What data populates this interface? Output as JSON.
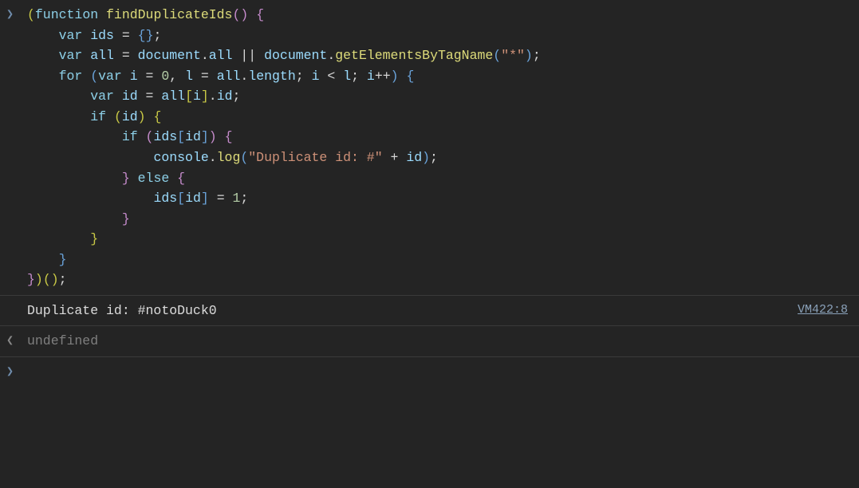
{
  "rows": [
    {
      "type": "input",
      "marker": "❯",
      "code_tokens": [
        [
          "t-paren",
          "("
        ],
        [
          "t-keyword",
          "function "
        ],
        [
          "t-name",
          "findDuplicateIds"
        ],
        [
          "t-paren2",
          "("
        ],
        [
          "t-paren2",
          ")"
        ],
        [
          "t-punc",
          " "
        ],
        [
          "t-paren2",
          "{"
        ],
        [
          "nl",
          ""
        ],
        [
          "indent",
          "    "
        ],
        [
          "t-keyword",
          "var "
        ],
        [
          "t-var",
          "ids"
        ],
        [
          "t-punc",
          " "
        ],
        [
          "t-op",
          "="
        ],
        [
          "t-punc",
          " "
        ],
        [
          "t-paren3",
          "{"
        ],
        [
          "t-paren3",
          "}"
        ],
        [
          "t-punc",
          ";"
        ],
        [
          "nl",
          ""
        ],
        [
          "indent",
          "    "
        ],
        [
          "t-keyword",
          "var "
        ],
        [
          "t-var",
          "all"
        ],
        [
          "t-punc",
          " "
        ],
        [
          "t-op",
          "="
        ],
        [
          "t-punc",
          " "
        ],
        [
          "t-var",
          "document"
        ],
        [
          "t-punc",
          "."
        ],
        [
          "t-var",
          "all"
        ],
        [
          "t-punc",
          " "
        ],
        [
          "t-op",
          "||"
        ],
        [
          "t-punc",
          " "
        ],
        [
          "t-var",
          "document"
        ],
        [
          "t-punc",
          "."
        ],
        [
          "t-method",
          "getElementsByTagName"
        ],
        [
          "t-paren3",
          "("
        ],
        [
          "t-str",
          "\"*\""
        ],
        [
          "t-paren3",
          ")"
        ],
        [
          "t-punc",
          ";"
        ],
        [
          "nl",
          ""
        ],
        [
          "indent",
          "    "
        ],
        [
          "t-keyword",
          "for "
        ],
        [
          "t-paren3",
          "("
        ],
        [
          "t-keyword",
          "var "
        ],
        [
          "t-var",
          "i"
        ],
        [
          "t-punc",
          " "
        ],
        [
          "t-op",
          "="
        ],
        [
          "t-punc",
          " "
        ],
        [
          "t-num",
          "0"
        ],
        [
          "t-punc",
          ", "
        ],
        [
          "t-var",
          "l"
        ],
        [
          "t-punc",
          " "
        ],
        [
          "t-op",
          "="
        ],
        [
          "t-punc",
          " "
        ],
        [
          "t-var",
          "all"
        ],
        [
          "t-punc",
          "."
        ],
        [
          "t-var",
          "length"
        ],
        [
          "t-punc",
          "; "
        ],
        [
          "t-var",
          "i"
        ],
        [
          "t-punc",
          " "
        ],
        [
          "t-op",
          "<"
        ],
        [
          "t-punc",
          " "
        ],
        [
          "t-var",
          "l"
        ],
        [
          "t-punc",
          "; "
        ],
        [
          "t-var",
          "i"
        ],
        [
          "t-op",
          "++"
        ],
        [
          "t-paren3",
          ")"
        ],
        [
          "t-punc",
          " "
        ],
        [
          "t-paren3",
          "{"
        ],
        [
          "nl",
          ""
        ],
        [
          "indent",
          "        "
        ],
        [
          "t-keyword",
          "var "
        ],
        [
          "t-var",
          "id"
        ],
        [
          "t-punc",
          " "
        ],
        [
          "t-op",
          "="
        ],
        [
          "t-punc",
          " "
        ],
        [
          "t-var",
          "all"
        ],
        [
          "t-paren",
          "["
        ],
        [
          "t-var",
          "i"
        ],
        [
          "t-paren",
          "]"
        ],
        [
          "t-punc",
          "."
        ],
        [
          "t-var",
          "id"
        ],
        [
          "t-punc",
          ";"
        ],
        [
          "nl",
          ""
        ],
        [
          "indent",
          "        "
        ],
        [
          "t-keyword",
          "if "
        ],
        [
          "t-paren",
          "("
        ],
        [
          "t-var",
          "id"
        ],
        [
          "t-paren",
          ")"
        ],
        [
          "t-punc",
          " "
        ],
        [
          "t-paren",
          "{"
        ],
        [
          "nl",
          ""
        ],
        [
          "indent",
          "            "
        ],
        [
          "t-keyword",
          "if "
        ],
        [
          "t-paren2",
          "("
        ],
        [
          "t-var",
          "ids"
        ],
        [
          "t-paren3",
          "["
        ],
        [
          "t-var",
          "id"
        ],
        [
          "t-paren3",
          "]"
        ],
        [
          "t-paren2",
          ")"
        ],
        [
          "t-punc",
          " "
        ],
        [
          "t-paren2",
          "{"
        ],
        [
          "nl",
          ""
        ],
        [
          "indent",
          "                "
        ],
        [
          "t-var",
          "console"
        ],
        [
          "t-punc",
          "."
        ],
        [
          "t-method",
          "log"
        ],
        [
          "t-paren3",
          "("
        ],
        [
          "t-str",
          "\"Duplicate id: #\""
        ],
        [
          "t-punc",
          " "
        ],
        [
          "t-op",
          "+"
        ],
        [
          "t-punc",
          " "
        ],
        [
          "t-var",
          "id"
        ],
        [
          "t-paren3",
          ")"
        ],
        [
          "t-punc",
          ";"
        ],
        [
          "nl",
          ""
        ],
        [
          "indent",
          "            "
        ],
        [
          "t-paren2",
          "}"
        ],
        [
          "t-punc",
          " "
        ],
        [
          "t-keyword",
          "else "
        ],
        [
          "t-paren2",
          "{"
        ],
        [
          "nl",
          ""
        ],
        [
          "indent",
          "                "
        ],
        [
          "t-var",
          "ids"
        ],
        [
          "t-paren3",
          "["
        ],
        [
          "t-var",
          "id"
        ],
        [
          "t-paren3",
          "]"
        ],
        [
          "t-punc",
          " "
        ],
        [
          "t-op",
          "="
        ],
        [
          "t-punc",
          " "
        ],
        [
          "t-num",
          "1"
        ],
        [
          "t-punc",
          ";"
        ],
        [
          "nl",
          ""
        ],
        [
          "indent",
          "            "
        ],
        [
          "t-paren2",
          "}"
        ],
        [
          "nl",
          ""
        ],
        [
          "indent",
          "        "
        ],
        [
          "t-paren",
          "}"
        ],
        [
          "nl",
          ""
        ],
        [
          "indent",
          "    "
        ],
        [
          "t-paren3",
          "}"
        ],
        [
          "nl",
          ""
        ],
        [
          "t-paren2",
          "}"
        ],
        [
          "t-paren",
          ")"
        ],
        [
          "t-paren",
          "("
        ],
        [
          "t-paren",
          ")"
        ],
        [
          "t-punc",
          ";"
        ]
      ]
    },
    {
      "type": "log",
      "text": "Duplicate id: #notoDuck0",
      "source": "VM422:8"
    },
    {
      "type": "return",
      "marker": "❮",
      "text": "undefined"
    },
    {
      "type": "prompt",
      "marker": "❯"
    }
  ]
}
